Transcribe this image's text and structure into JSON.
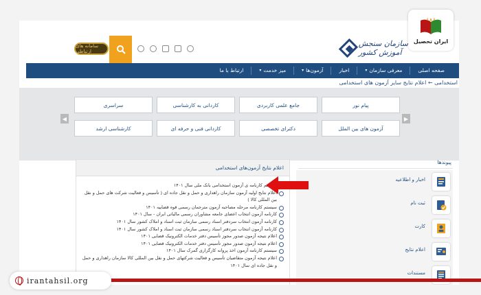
{
  "watermark": {
    "brand": "ایران تحصیل",
    "url": "irantahsil.org",
    "accent": "#b91515"
  },
  "header": {
    "site_name": "سازمان سنجش آموزش کشور",
    "gold_button_label": "سامانه های ارتباطی",
    "search_icon": "search-icon",
    "icons": [
      "rss-icon",
      "home-icon",
      "grid-icon",
      "share-icon",
      "globe-icon"
    ]
  },
  "nav": {
    "items": [
      {
        "label": "صفحه اصلی",
        "has_menu": false
      },
      {
        "label": "معرفی سازمان",
        "has_menu": true
      },
      {
        "label": "اخبار",
        "has_menu": false
      },
      {
        "label": "آزمون‌ها",
        "has_menu": true
      },
      {
        "label": "میز خدمت",
        "has_menu": true
      },
      {
        "label": "ارتباط با ما",
        "has_menu": false
      }
    ],
    "color": "#1f4d80"
  },
  "breadcrumb": "استخدامی ← اعلام نتایج سایر آزمون های استخدامی",
  "exam_buttons": {
    "row1": [
      "پیام نور",
      "جامع علمی کاربردی",
      "کاردانی به کارشناسی",
      "سراسری"
    ],
    "row2": [
      "آزمون های بین الملل",
      "دکترای تخصصی",
      "کاردانی فنی و حرفه ای",
      "کارشناسی ارشد"
    ],
    "prev_arrow": "◀",
    "next_arrow": "▶"
  },
  "panel": {
    "title": "اعلام نتایج آزمون‌های استخدامی",
    "items": [
      "سیستم کارنامه ی آزمون استخدامی بانک ملی سال ۱۴۰۱",
      "اعلام نتایج اولیه آزمون سازمان راهداری و حمل و نقل جاده ای ( تأسیس و فعالیت شرکت های حمل و نقل بین المللی کالا )",
      "سیستم کارنامه مرحله مصاحبه آزمون مترجمان رسمی قوه قضاییه ۱۴۰۱",
      "کارنامه آزمون انتخاب اعضای جامعه مشاوران رسمی مالیاتی ایران - سال ۱۴۰۱",
      "کارنامه آزمون انتخاب سردفتر اسناد رسمی سازمان ثبت اسناد و املاک کشور سال ۱۴۰۱",
      "کارنامه آزمون انتخاب سردفتر اسناد رسمی سازمان ثبت اسناد و املاک کشور سال ۱۴۰۱",
      "اعلام نتیجه آزمون صدور مجوز تأسیس دفتر خدمات الکترونیک قضایی ۱۴۰۱",
      "اعلام نتیجه آزمون صدور مجوز تأسیس دفتر خدمات الکترونیک قضایی ۱۴۰۱",
      "سیستم کارنامه آزمون اخذ پروانه کارگزاری گمرک سال ۱۴۰۱",
      "اعلام نتیجه آزمون متقاضیان تأسیس و فعالیت شرکتهای حمل و نقل بین المللی کالا سازمان راهداری و حمل و نقل جاده ای سال ۱۴۰۱"
    ]
  },
  "sidebar": {
    "title": "پیوندها",
    "items": [
      {
        "label": "اخبار و اطلاعیه",
        "icon": "news-icon"
      },
      {
        "label": "ثبت نام",
        "icon": "register-icon"
      },
      {
        "label": "کارت",
        "icon": "card-icon"
      },
      {
        "label": "اعلام نتایج",
        "icon": "results-icon"
      },
      {
        "label": "مستندات",
        "icon": "documents-icon"
      }
    ]
  }
}
